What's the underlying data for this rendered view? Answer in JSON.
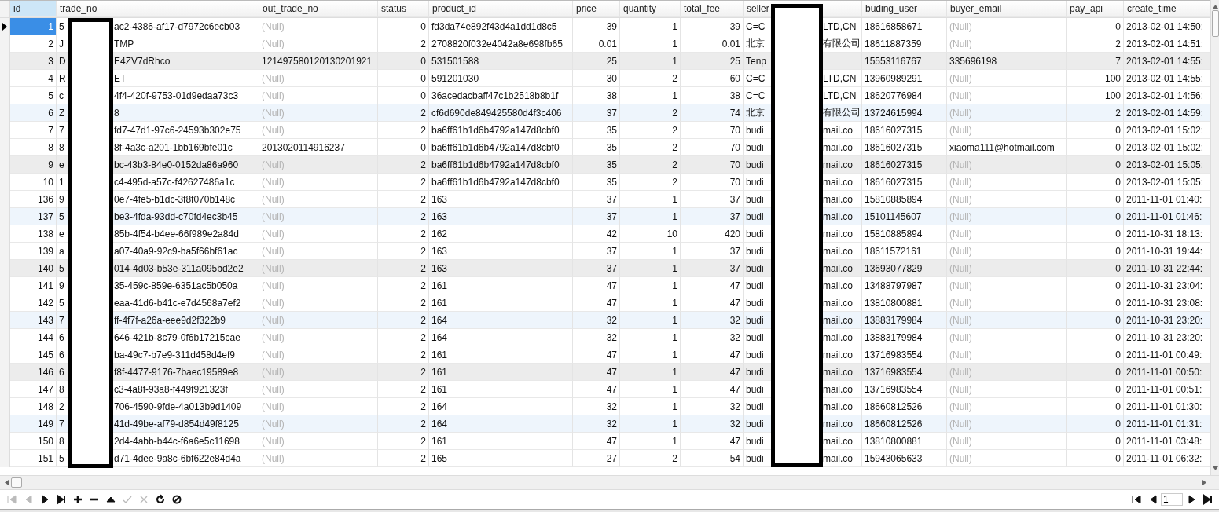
{
  "table": {
    "columns": [
      {
        "label": "id",
        "selected": true
      },
      {
        "label": "trade_no",
        "selected": false
      },
      {
        "label": "out_trade_no",
        "selected": false
      },
      {
        "label": "status",
        "selected": false
      },
      {
        "label": "product_id",
        "selected": false
      },
      {
        "label": "price",
        "selected": false
      },
      {
        "label": "quantity",
        "selected": false
      },
      {
        "label": "total_fee",
        "selected": false
      },
      {
        "label": "seller",
        "selected": false
      },
      {
        "label": "buding_user",
        "selected": false
      },
      {
        "label": "buyer_email",
        "selected": false
      },
      {
        "label": "pay_api",
        "selected": false
      },
      {
        "label": "create_time",
        "selected": false
      }
    ],
    "rows": [
      {
        "selected": true,
        "id": "1",
        "trade_no": {
          "start": "5",
          "end": "ac2-4386-af17-d7972c6ecb03"
        },
        "out_trade_no": {
          "text": "(Null)",
          "null": true
        },
        "status": "0",
        "product_id": "fd3da74e892f43d4a1dd1d8c5",
        "price": "39",
        "quantity": "1",
        "total_fee": "39",
        "seller": {
          "start": "C=C",
          "end": "LTD,CN"
        },
        "buding_user": "18616858671",
        "buyer_email": {
          "text": "(Null)",
          "null": true
        },
        "pay_api": "0",
        "create_time": "2013-02-01 14:50:"
      },
      {
        "selected": false,
        "id": "2",
        "trade_no": {
          "start": "J",
          "end": "TMP"
        },
        "out_trade_no": {
          "text": "(Null)",
          "null": true
        },
        "status": "2",
        "product_id": "2708820f032e4042a8e698fb65",
        "price": "0.01",
        "quantity": "1",
        "total_fee": "0.01",
        "seller": {
          "start": "北京",
          "end": "有限公司"
        },
        "buding_user": "18611887359",
        "buyer_email": {
          "text": "(Null)",
          "null": true
        },
        "pay_api": "2",
        "create_time": "2013-02-01 14:51:"
      },
      {
        "selected": false,
        "id": "3",
        "trade_no": {
          "start": "D",
          "end": "E4ZV7dRhco"
        },
        "out_trade_no": {
          "text": "121497580120130201921",
          "null": false
        },
        "status": "0",
        "product_id": "531501588",
        "price": "25",
        "quantity": "1",
        "total_fee": "25",
        "seller": {
          "start": "Tenp"
        },
        "buding_user": "15553116767",
        "buyer_email": {
          "text": "335696198",
          "null": false
        },
        "pay_api": "7",
        "create_time": "2013-02-01 14:55:"
      },
      {
        "selected": false,
        "id": "4",
        "trade_no": {
          "start": "R",
          "end": "ET"
        },
        "out_trade_no": {
          "text": "(Null)",
          "null": true
        },
        "status": "0",
        "product_id": "591201030",
        "price": "30",
        "quantity": "2",
        "total_fee": "60",
        "seller": {
          "start": "C=C",
          "end": "LTD,CN"
        },
        "buding_user": "13960989291",
        "buyer_email": {
          "text": "(Null)",
          "null": true
        },
        "pay_api": "100",
        "create_time": "2013-02-01 14:55:"
      },
      {
        "selected": false,
        "id": "5",
        "trade_no": {
          "start": "c",
          "end": "4f4-420f-9753-01d9edaa73c3"
        },
        "out_trade_no": {
          "text": "(Null)",
          "null": true
        },
        "status": "0",
        "product_id": "36acedacbaff47c1b2518b8b1f",
        "price": "38",
        "quantity": "1",
        "total_fee": "38",
        "seller": {
          "start": "C=C",
          "end": "LTD,CN"
        },
        "buding_user": "18620776984",
        "buyer_email": {
          "text": "(Null)",
          "null": true
        },
        "pay_api": "100",
        "create_time": "2013-02-01 14:56:"
      },
      {
        "selected": false,
        "id": "6",
        "trade_no": {
          "start": "Z",
          "end": "8"
        },
        "out_trade_no": {
          "text": "(Null)",
          "null": true
        },
        "status": "2",
        "product_id": "cf6d690de849425580d4f3c406",
        "price": "37",
        "quantity": "2",
        "total_fee": "74",
        "seller": {
          "start": "北京",
          "end": "有限公司"
        },
        "buding_user": "13724615994",
        "buyer_email": {
          "text": "(Null)",
          "null": true
        },
        "pay_api": "2",
        "create_time": "2013-02-01 14:59:"
      },
      {
        "selected": false,
        "id": "7",
        "trade_no": {
          "start": "7",
          "end": "fd7-47d1-97c6-24593b302e75"
        },
        "out_trade_no": {
          "text": "(Null)",
          "null": true
        },
        "status": "2",
        "product_id": "ba6ff61b1d6b4792a147d8cbf0",
        "price": "35",
        "quantity": "2",
        "total_fee": "70",
        "seller": {
          "start": "budi",
          "end": "mail.co"
        },
        "buding_user": "18616027315",
        "buyer_email": {
          "text": "(Null)",
          "null": true
        },
        "pay_api": "0",
        "create_time": "2013-02-01 15:02:"
      },
      {
        "selected": false,
        "id": "8",
        "trade_no": {
          "start": "8",
          "end": "8f-4a3c-a201-1bb169bfe01c"
        },
        "out_trade_no": {
          "text": "2013020114916237",
          "null": false
        },
        "status": "0",
        "product_id": "ba6ff61b1d6b4792a147d8cbf0",
        "price": "35",
        "quantity": "2",
        "total_fee": "70",
        "seller": {
          "start": "budi",
          "end": "mail.co"
        },
        "buding_user": "18616027315",
        "buyer_email": {
          "text": "xiaoma111@hotmail.com",
          "null": false
        },
        "pay_api": "0",
        "create_time": "2013-02-01 15:02:"
      },
      {
        "selected": false,
        "id": "9",
        "trade_no": {
          "start": "e",
          "end": "bc-43b3-84e0-0152da86a960"
        },
        "out_trade_no": {
          "text": "(Null)",
          "null": true
        },
        "status": "2",
        "product_id": "ba6ff61b1d6b4792a147d8cbf0",
        "price": "35",
        "quantity": "2",
        "total_fee": "70",
        "seller": {
          "start": "budi",
          "end": "mail.co"
        },
        "buding_user": "18616027315",
        "buyer_email": {
          "text": "(Null)",
          "null": true
        },
        "pay_api": "0",
        "create_time": "2013-02-01 15:05:"
      },
      {
        "selected": false,
        "id": "10",
        "trade_no": {
          "start": "1",
          "end": "c4-495d-a57c-f42627486a1c"
        },
        "out_trade_no": {
          "text": "(Null)",
          "null": true
        },
        "status": "2",
        "product_id": "ba6ff61b1d6b4792a147d8cbf0",
        "price": "35",
        "quantity": "2",
        "total_fee": "70",
        "seller": {
          "start": "budi",
          "end": "mail.co"
        },
        "buding_user": "18616027315",
        "buyer_email": {
          "text": "(Null)",
          "null": true
        },
        "pay_api": "0",
        "create_time": "2013-02-01 15:05:"
      },
      {
        "selected": false,
        "id": "136",
        "trade_no": {
          "start": "9",
          "end": "0e7-4fe5-b1dc-3f8f070b148c"
        },
        "out_trade_no": {
          "text": "(Null)",
          "null": true
        },
        "status": "2",
        "product_id": "163",
        "price": "37",
        "quantity": "1",
        "total_fee": "37",
        "seller": {
          "start": "budi",
          "end": "mail.co"
        },
        "buding_user": "15810885894",
        "buyer_email": {
          "text": "(Null)",
          "null": true
        },
        "pay_api": "0",
        "create_time": "2011-11-01 01:40:"
      },
      {
        "selected": false,
        "id": "137",
        "trade_no": {
          "start": "5",
          "end": "be3-4fda-93dd-c70fd4ec3b45"
        },
        "out_trade_no": {
          "text": "(Null)",
          "null": true
        },
        "status": "2",
        "product_id": "163",
        "price": "37",
        "quantity": "1",
        "total_fee": "37",
        "seller": {
          "start": "budi",
          "end": "mail.co"
        },
        "buding_user": "15101145607",
        "buyer_email": {
          "text": "(Null)",
          "null": true
        },
        "pay_api": "0",
        "create_time": "2011-11-01 01:46:"
      },
      {
        "selected": false,
        "id": "138",
        "trade_no": {
          "start": "e",
          "end": "85b-4f54-b4ee-66f989e2a84d"
        },
        "out_trade_no": {
          "text": "(Null)",
          "null": true
        },
        "status": "2",
        "product_id": "162",
        "price": "42",
        "quantity": "10",
        "total_fee": "420",
        "seller": {
          "start": "budi",
          "end": "mail.co"
        },
        "buding_user": "15810885894",
        "buyer_email": {
          "text": "(Null)",
          "null": true
        },
        "pay_api": "0",
        "create_time": "2011-10-31 18:13:"
      },
      {
        "selected": false,
        "id": "139",
        "trade_no": {
          "start": "a",
          "end": "a07-40a9-92c9-ba5f66bf61ac"
        },
        "out_trade_no": {
          "text": "(Null)",
          "null": true
        },
        "status": "2",
        "product_id": "163",
        "price": "37",
        "quantity": "1",
        "total_fee": "37",
        "seller": {
          "start": "budi",
          "end": "mail.co"
        },
        "buding_user": "18611572161",
        "buyer_email": {
          "text": "(Null)",
          "null": true
        },
        "pay_api": "0",
        "create_time": "2011-10-31 19:44:"
      },
      {
        "selected": false,
        "id": "140",
        "trade_no": {
          "start": "5",
          "end": "014-4d03-b53e-311a095bd2e2"
        },
        "out_trade_no": {
          "text": "(Null)",
          "null": true
        },
        "status": "2",
        "product_id": "163",
        "price": "37",
        "quantity": "1",
        "total_fee": "37",
        "seller": {
          "start": "budi",
          "end": "mail.co"
        },
        "buding_user": "13693077829",
        "buyer_email": {
          "text": "(Null)",
          "null": true
        },
        "pay_api": "0",
        "create_time": "2011-10-31 22:44:"
      },
      {
        "selected": false,
        "id": "141",
        "trade_no": {
          "start": "9",
          "end": "35-459c-859e-6351ac5b050a"
        },
        "out_trade_no": {
          "text": "(Null)",
          "null": true
        },
        "status": "2",
        "product_id": "161",
        "price": "47",
        "quantity": "1",
        "total_fee": "47",
        "seller": {
          "start": "budi",
          "end": "mail.co"
        },
        "buding_user": "13488797987",
        "buyer_email": {
          "text": "(Null)",
          "null": true
        },
        "pay_api": "0",
        "create_time": "2011-10-31 23:04:"
      },
      {
        "selected": false,
        "id": "142",
        "trade_no": {
          "start": "5",
          "end": "eaa-41d6-b41c-e7d4568a7ef2"
        },
        "out_trade_no": {
          "text": "(Null)",
          "null": true
        },
        "status": "2",
        "product_id": "161",
        "price": "47",
        "quantity": "1",
        "total_fee": "47",
        "seller": {
          "start": "budi",
          "end": "mail.co"
        },
        "buding_user": "13810800881",
        "buyer_email": {
          "text": "(Null)",
          "null": true
        },
        "pay_api": "0",
        "create_time": "2011-10-31 23:08:"
      },
      {
        "selected": false,
        "id": "143",
        "trade_no": {
          "start": "7",
          "end": "ff-4f7f-a26a-eee9d2f322b9"
        },
        "out_trade_no": {
          "text": "(Null)",
          "null": true
        },
        "status": "2",
        "product_id": "164",
        "price": "32",
        "quantity": "1",
        "total_fee": "32",
        "seller": {
          "start": "budi",
          "end": "mail.co"
        },
        "buding_user": "13883179984",
        "buyer_email": {
          "text": "(Null)",
          "null": true
        },
        "pay_api": "0",
        "create_time": "2011-10-31 23:20:"
      },
      {
        "selected": false,
        "id": "144",
        "trade_no": {
          "start": "6",
          "end": "646-421b-8c79-0f6b17215cae"
        },
        "out_trade_no": {
          "text": "(Null)",
          "null": true
        },
        "status": "2",
        "product_id": "164",
        "price": "32",
        "quantity": "1",
        "total_fee": "32",
        "seller": {
          "start": "budi",
          "end": "mail.co"
        },
        "buding_user": "13883179984",
        "buyer_email": {
          "text": "(Null)",
          "null": true
        },
        "pay_api": "0",
        "create_time": "2011-10-31 23:20:"
      },
      {
        "selected": false,
        "id": "145",
        "trade_no": {
          "start": "6",
          "end": "ba-49c7-b7e9-311d458d4ef9"
        },
        "out_trade_no": {
          "text": "(Null)",
          "null": true
        },
        "status": "2",
        "product_id": "161",
        "price": "47",
        "quantity": "1",
        "total_fee": "47",
        "seller": {
          "start": "budi",
          "end": "mail.co"
        },
        "buding_user": "13716983554",
        "buyer_email": {
          "text": "(Null)",
          "null": true
        },
        "pay_api": "0",
        "create_time": "2011-11-01 00:49:"
      },
      {
        "selected": false,
        "id": "146",
        "trade_no": {
          "start": "6",
          "end": "f8f-4477-9176-7baec19589e8"
        },
        "out_trade_no": {
          "text": "(Null)",
          "null": true
        },
        "status": "2",
        "product_id": "161",
        "price": "47",
        "quantity": "1",
        "total_fee": "47",
        "seller": {
          "start": "budi",
          "end": "mail.co"
        },
        "buding_user": "13716983554",
        "buyer_email": {
          "text": "(Null)",
          "null": true
        },
        "pay_api": "0",
        "create_time": "2011-11-01 00:50:"
      },
      {
        "selected": false,
        "id": "147",
        "trade_no": {
          "start": "8",
          "end": "c3-4a8f-93a8-f449f921323f"
        },
        "out_trade_no": {
          "text": "(Null)",
          "null": true
        },
        "status": "2",
        "product_id": "161",
        "price": "47",
        "quantity": "1",
        "total_fee": "47",
        "seller": {
          "start": "budi",
          "end": "mail.co"
        },
        "buding_user": "13716983554",
        "buyer_email": {
          "text": "(Null)",
          "null": true
        },
        "pay_api": "0",
        "create_time": "2011-11-01 00:51:"
      },
      {
        "selected": false,
        "id": "148",
        "trade_no": {
          "start": "2",
          "end": "706-4590-9fde-4a013b9d1409"
        },
        "out_trade_no": {
          "text": "(Null)",
          "null": true
        },
        "status": "2",
        "product_id": "164",
        "price": "32",
        "quantity": "1",
        "total_fee": "32",
        "seller": {
          "start": "budi",
          "end": "mail.co"
        },
        "buding_user": "18660812526",
        "buyer_email": {
          "text": "(Null)",
          "null": true
        },
        "pay_api": "0",
        "create_time": "2011-11-01 01:30:"
      },
      {
        "selected": false,
        "id": "149",
        "trade_no": {
          "start": "7",
          "end": "41d-49be-af79-d854d49f8125"
        },
        "out_trade_no": {
          "text": "(Null)",
          "null": true
        },
        "status": "2",
        "product_id": "164",
        "price": "32",
        "quantity": "1",
        "total_fee": "32",
        "seller": {
          "start": "budi",
          "end": "mail.co"
        },
        "buding_user": "18660812526",
        "buyer_email": {
          "text": "(Null)",
          "null": true
        },
        "pay_api": "0",
        "create_time": "2011-11-01 01:31:"
      },
      {
        "selected": false,
        "id": "150",
        "trade_no": {
          "start": "8",
          "end": "2d4-4abb-b44c-f6a6e5c11698"
        },
        "out_trade_no": {
          "text": "(Null)",
          "null": true
        },
        "status": "2",
        "product_id": "161",
        "price": "47",
        "quantity": "1",
        "total_fee": "47",
        "seller": {
          "start": "budi",
          "end": "mail.co"
        },
        "buding_user": "13810800881",
        "buyer_email": {
          "text": "(Null)",
          "null": true
        },
        "pay_api": "0",
        "create_time": "2011-11-01 03:48:"
      },
      {
        "selected": false,
        "id": "151",
        "trade_no": {
          "start": "5",
          "end": "d71-4dee-9a8c-6bf622e84d4a"
        },
        "out_trade_no": {
          "text": "(Null)",
          "null": true
        },
        "status": "2",
        "product_id": "165",
        "price": "27",
        "quantity": "2",
        "total_fee": "54",
        "seller": {
          "start": "budi",
          "end": "mail.co"
        },
        "buding_user": "15943065633",
        "buyer_email": {
          "text": "(Null)",
          "null": true
        },
        "pay_api": "0",
        "create_time": "2011-11-01 06:32:"
      }
    ]
  },
  "toolbar": [
    {
      "kind": "first",
      "disabled": true
    },
    {
      "kind": "prev",
      "disabled": true
    },
    {
      "kind": "next",
      "disabled": false
    },
    {
      "kind": "last",
      "disabled": false
    },
    {
      "kind": "add",
      "disabled": false
    },
    {
      "kind": "delete",
      "disabled": false
    },
    {
      "kind": "up",
      "disabled": false
    },
    {
      "kind": "apply",
      "disabled": true
    },
    {
      "kind": "cancel",
      "disabled": true
    },
    {
      "kind": "refresh",
      "disabled": false
    },
    {
      "kind": "stop",
      "disabled": false
    }
  ],
  "pager": {
    "page": "1",
    "buttons": [
      {
        "kind": "first"
      },
      {
        "kind": "prev"
      },
      {
        "kind": "next"
      },
      {
        "kind": "last"
      }
    ]
  }
}
